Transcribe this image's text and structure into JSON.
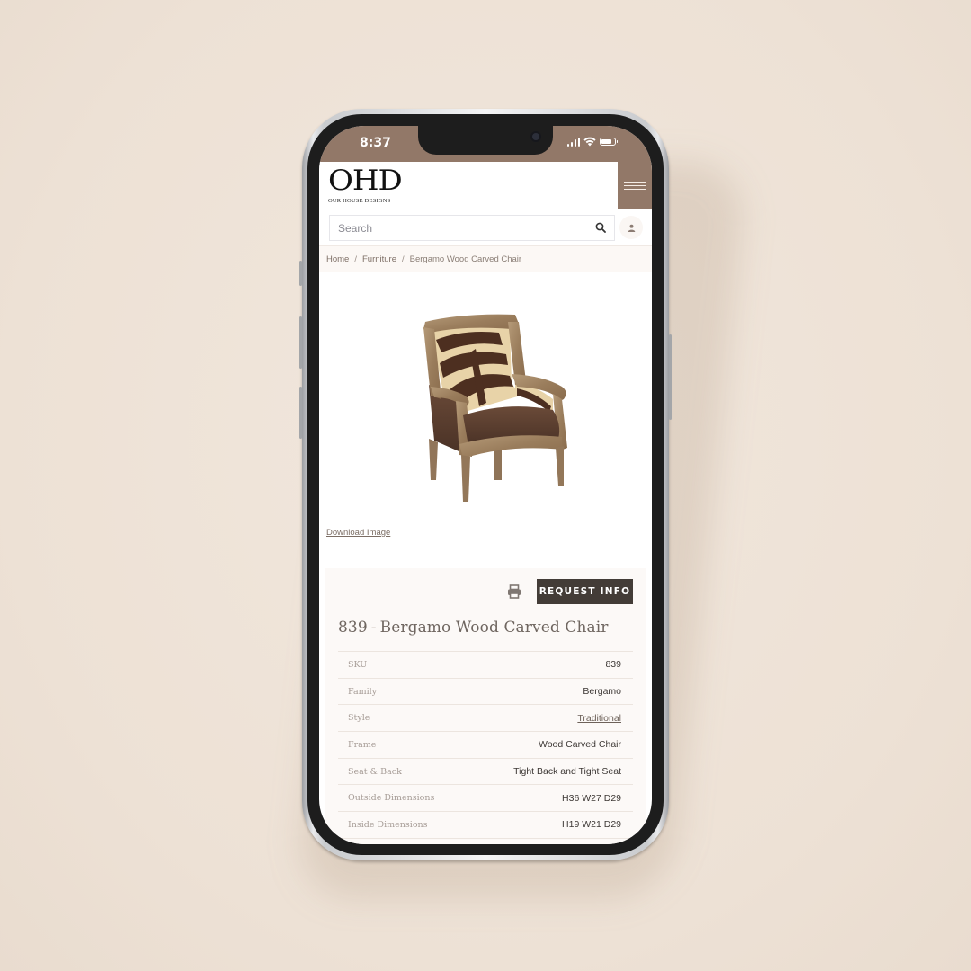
{
  "status_bar": {
    "time": "8:37",
    "icons": [
      "cellular-signal-icon",
      "wifi-icon",
      "battery-icon"
    ]
  },
  "colors": {
    "brand_header": "#927868",
    "button_dark": "#433c37",
    "background": "#efe4d9"
  },
  "header": {
    "logo_text": "OHD",
    "logo_subtext": "OUR HOUSE DESIGNS",
    "menu_icon": "hamburger-menu-icon"
  },
  "search": {
    "placeholder": "Search",
    "value": "",
    "search_icon": "search-icon",
    "account_icon": "user-icon"
  },
  "breadcrumb": {
    "items": [
      {
        "label": "Home",
        "link": true
      },
      {
        "label": "Furniture",
        "link": true
      },
      {
        "label": "Bergamo Wood Carved Chair",
        "link": false
      }
    ],
    "separator": "/"
  },
  "product_image": {
    "alt": "Bergamo Wood Carved Chair with zebra-print back and brown leather seat",
    "download_label": "Download Image"
  },
  "actions": {
    "print_icon": "print-icon",
    "request_label": "REQUEST INFO"
  },
  "product": {
    "number": "839",
    "separator": "-",
    "name": "Bergamo Wood Carved Chair"
  },
  "specs": [
    {
      "label": "SKU",
      "value": "839",
      "link": false
    },
    {
      "label": "Family",
      "value": "Bergamo",
      "link": false
    },
    {
      "label": "Style",
      "value": "Traditional",
      "link": true
    },
    {
      "label": "Frame",
      "value": "Wood Carved Chair",
      "link": false
    },
    {
      "label": "Seat & Back",
      "value": "Tight Back and Tight Seat",
      "link": false
    },
    {
      "label": "Outside Dimensions",
      "value": "H36 W27 D29",
      "link": false
    },
    {
      "label": "Inside Dimensions",
      "value": "H19 W21 D29",
      "link": false
    }
  ]
}
